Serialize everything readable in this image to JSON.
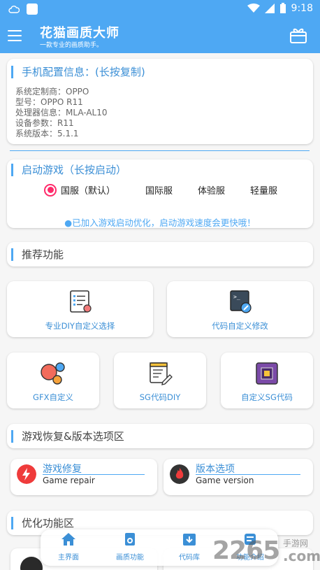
{
  "statusbar": {
    "time": "9:18"
  },
  "header": {
    "title": "花猫画质大师",
    "subtitle": "一款专业的画质助手。"
  },
  "phone_info": {
    "title": "手机配置信息：(长按复制)",
    "lines": [
      "系统定制商：OPPO",
      "型号：OPPO R11",
      "处理器信息：MLA-AL10",
      "设备参数：R11",
      "系统版本：5.1.1"
    ]
  },
  "launch": {
    "title": "启动游戏（长按启动）",
    "options": [
      "国服（默认）",
      "国际服",
      "体验服",
      "轻量服"
    ],
    "selected": "国服（默认）",
    "note": "●已加入游戏启动优化，启动游戏速度会更快哦！"
  },
  "recommend": {
    "title": "推荐功能",
    "tiles_row1": [
      {
        "label": "专业DIY自定义选择",
        "icon": "checklist-icon"
      },
      {
        "label": "代码自定义修改",
        "icon": "code-edit-icon"
      }
    ],
    "tiles_row2": [
      {
        "label": "GFX自定义",
        "icon": "bubbles-icon"
      },
      {
        "label": "SG代码DIY",
        "icon": "document-edit-icon"
      },
      {
        "label": "自定义SG代码",
        "icon": "chip-icon"
      }
    ]
  },
  "recovery": {
    "title": "游戏恢复&版本选项区",
    "items": [
      {
        "title": "游戏修复",
        "subtitle": "Game repair",
        "icon": "lightning-icon"
      },
      {
        "title": "版本选项",
        "subtitle": "Game version",
        "icon": "flame-icon"
      }
    ]
  },
  "optimize": {
    "title": "优化功能区"
  },
  "bottomnav": {
    "items": [
      {
        "label": "主界面",
        "icon": "home-icon"
      },
      {
        "label": "画质功能",
        "icon": "quality-icon"
      },
      {
        "label": "代码库",
        "icon": "download-box-icon"
      },
      {
        "label": "功能介绍",
        "icon": "info-icon"
      }
    ]
  },
  "watermark": {
    "brand": "2265",
    "domain": ".com",
    "tag": "手游网"
  },
  "colors": {
    "primary": "#4ea8f3",
    "accent_pink": "#ff2a6a",
    "link_blue": "#3b8fd6"
  }
}
